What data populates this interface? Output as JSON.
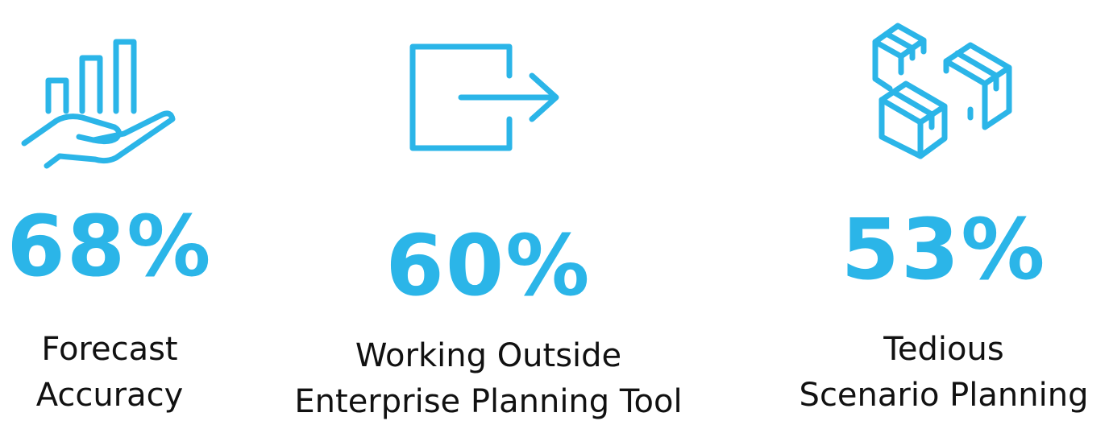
{
  "theme": {
    "accent_color": "#2bb5e8",
    "text_color": "#111111"
  },
  "stats": [
    {
      "icon": "hand-holding-bar-chart-icon",
      "value": "68%",
      "label_lines": [
        "Forecast",
        "Accuracy"
      ]
    },
    {
      "icon": "exit-arrow-icon",
      "value": "60%",
      "label_lines": [
        "Working Outside",
        "Enterprise Planning Tool"
      ]
    },
    {
      "icon": "stacked-boxes-icon",
      "value": "53%",
      "label_lines": [
        "Tedious",
        "Scenario Planning"
      ]
    }
  ]
}
